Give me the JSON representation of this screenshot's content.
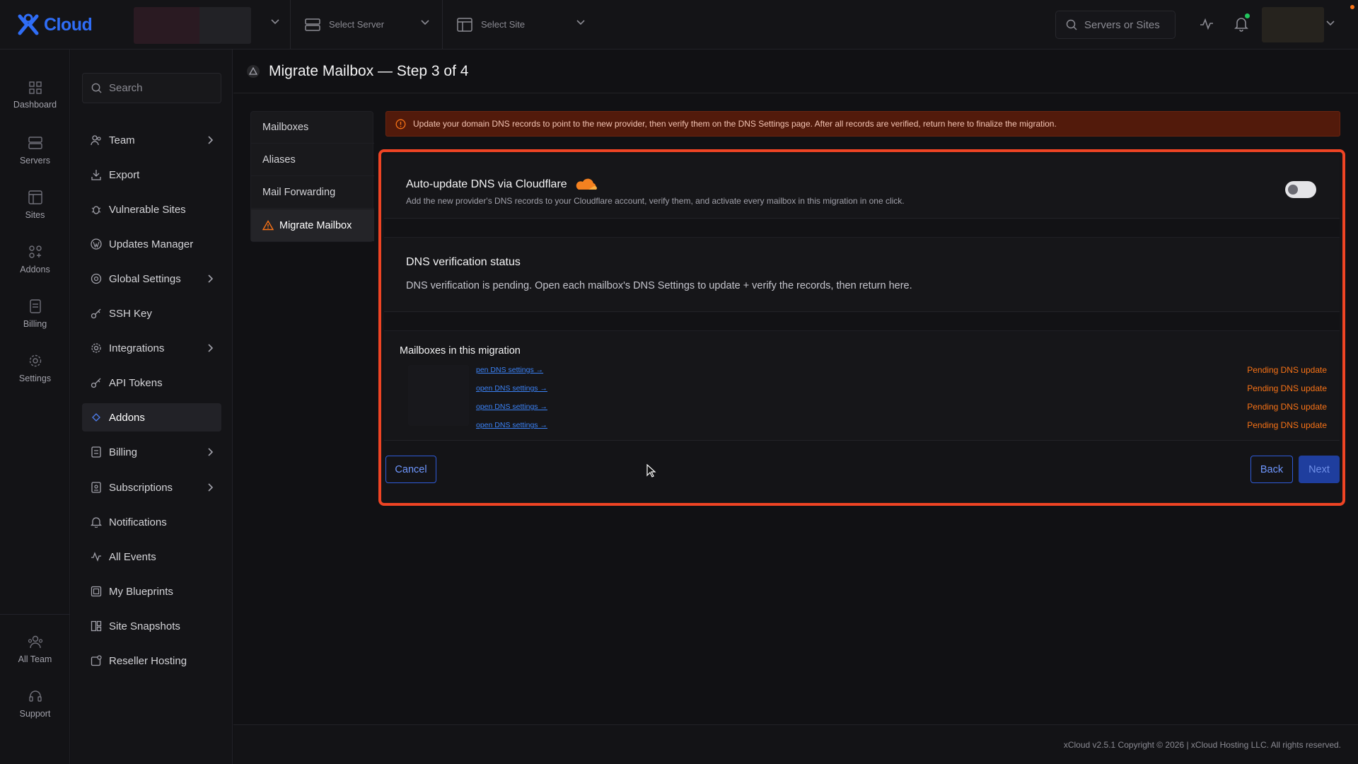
{
  "brand": {
    "name": "Cloud",
    "color": "#2f6df6"
  },
  "topbar": {
    "server_select": "Select Server",
    "site_select": "Select Site",
    "search_placeholder": "Servers or Sites"
  },
  "rail": {
    "items": [
      {
        "label": "Dashboard",
        "icon": "grid-icon"
      },
      {
        "label": "Servers",
        "icon": "server-icon"
      },
      {
        "label": "Sites",
        "icon": "browser-icon"
      },
      {
        "label": "Addons",
        "icon": "addons-icon"
      },
      {
        "label": "Billing",
        "icon": "billing-icon"
      },
      {
        "label": "Settings",
        "icon": "gear-icon"
      }
    ],
    "bottom": [
      {
        "label": "All Team",
        "icon": "team-icon"
      },
      {
        "label": "Support",
        "icon": "headset-icon"
      }
    ]
  },
  "sidebar": {
    "search_placeholder": "Search",
    "items": [
      {
        "label": "Team",
        "icon": "team-icon",
        "has_arrow": true
      },
      {
        "label": "Export",
        "icon": "download-icon"
      },
      {
        "label": "Vulnerable Sites",
        "icon": "bug-icon"
      },
      {
        "label": "Updates Manager",
        "icon": "wordpress-icon"
      },
      {
        "label": "Global Settings",
        "icon": "globe-settings-icon",
        "has_arrow": true
      },
      {
        "label": "SSH Key",
        "icon": "key-icon"
      },
      {
        "label": "Integrations",
        "icon": "gear-icon",
        "has_arrow": true
      },
      {
        "label": "API Tokens",
        "icon": "key-icon"
      },
      {
        "label": "Addons",
        "icon": "addons-icon",
        "active": true
      },
      {
        "label": "Billing",
        "icon": "billing-icon",
        "has_arrow": true
      },
      {
        "label": "Subscriptions",
        "icon": "subscription-icon",
        "has_arrow": true
      },
      {
        "label": "Notifications",
        "icon": "bell-icon"
      },
      {
        "label": "All Events",
        "icon": "activity-icon"
      },
      {
        "label": "My Blueprints",
        "icon": "blueprint-icon"
      },
      {
        "label": "Site Snapshots",
        "icon": "snapshot-icon"
      },
      {
        "label": "Reseller Hosting",
        "icon": "reseller-icon"
      }
    ]
  },
  "page": {
    "title": "Migrate Mailbox — Step 3 of 4"
  },
  "tabs": [
    {
      "label": "Mailboxes"
    },
    {
      "label": "Aliases"
    },
    {
      "label": "Mail Forwarding"
    },
    {
      "label": "Migrate Mailbox",
      "active": true,
      "icon": "warning-icon"
    }
  ],
  "alert": {
    "text": "Update your domain DNS records to point to the new provider, then verify them on the DNS Settings page. After all records are verified, return here to finalize the migration.",
    "color": "#521a0b"
  },
  "cloudflare": {
    "title": "Auto-update DNS via Cloudflare",
    "description": "Add the new provider's DNS records to your Cloudflare account, verify them, and activate every mailbox in this migration in one click.",
    "toggle_on": false
  },
  "dns_status": {
    "title": "DNS verification status",
    "text": "DNS verification is pending. Open each mailbox's DNS Settings to update + verify the records, then return here."
  },
  "mailboxes": {
    "title": "Mailboxes in this migration",
    "rows": [
      {
        "link": "pen DNS settings →",
        "status": "Pending DNS update"
      },
      {
        "link": "open DNS settings →",
        "status": "Pending DNS update"
      },
      {
        "link": "open DNS settings →",
        "status": "Pending DNS update"
      },
      {
        "link": "open DNS settings →",
        "status": "Pending DNS update"
      }
    ],
    "status_color": "#f97316"
  },
  "actions": {
    "cancel": "Cancel",
    "back": "Back",
    "next": "Next"
  },
  "footer": {
    "text": "xCloud v2.5.1 Copyright © 2026 | xCloud Hosting LLC. All rights reserved."
  },
  "accent": {
    "highlight_border": "#ef4424",
    "button_blue": "#2f5bd8"
  }
}
